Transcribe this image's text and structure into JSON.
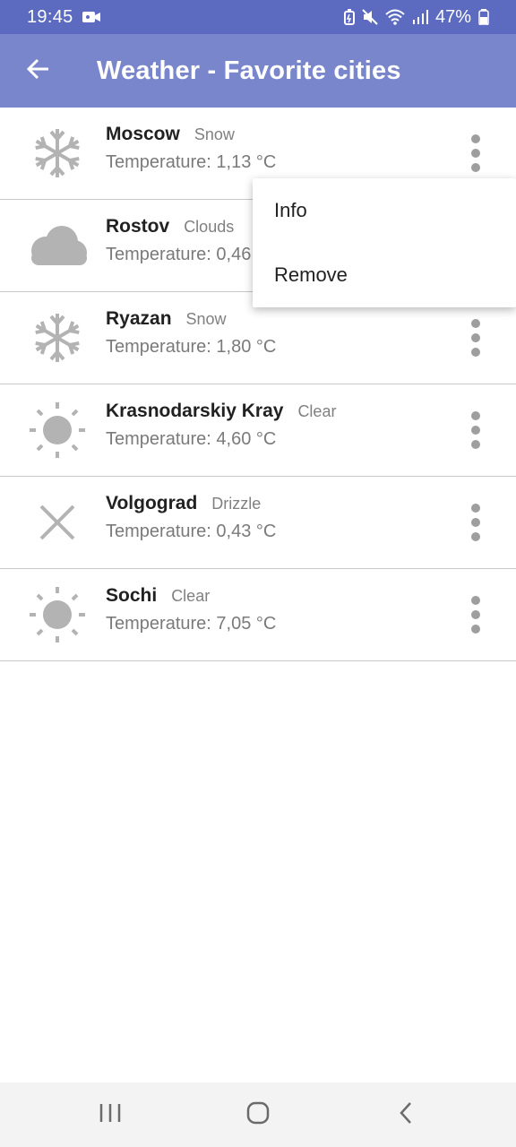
{
  "status_bar": {
    "time": "19:45",
    "battery": "47%",
    "icons": [
      "video-camera-icon",
      "battery-saver-icon",
      "mute-icon",
      "wifi-icon",
      "signal-icon",
      "battery-icon"
    ]
  },
  "app_bar": {
    "title": "Weather - Favorite cities",
    "back_icon": "arrow-left-icon"
  },
  "cities": [
    {
      "name": "Moscow",
      "condition": "Snow",
      "temperature": "Temperature: 1,13 °C",
      "icon": "snowflake-icon"
    },
    {
      "name": "Rostov",
      "condition": "Clouds",
      "temperature": "Temperature: 0,46",
      "icon": "cloud-icon"
    },
    {
      "name": "Ryazan",
      "condition": "Snow",
      "temperature": "Temperature: 1,80 °C",
      "icon": "snowflake-icon"
    },
    {
      "name": "Krasnodarskiy Kray",
      "condition": "Clear",
      "temperature": "Temperature: 4,60 °C",
      "icon": "sun-icon"
    },
    {
      "name": "Volgograd",
      "condition": "Drizzle",
      "temperature": "Temperature: 0,43 °C",
      "icon": "cross-icon"
    },
    {
      "name": "Sochi",
      "condition": "Clear",
      "temperature": "Temperature: 7,05 °C",
      "icon": "sun-icon"
    }
  ],
  "popup_menu": {
    "items": [
      "Info",
      "Remove"
    ]
  },
  "nav_bar": {
    "icons": [
      "recent-apps-icon",
      "home-icon",
      "back-icon"
    ]
  },
  "colors": {
    "status_bar": "#5c6bc0",
    "app_bar": "#7986cb",
    "icon_gray": "#b3b3b3"
  }
}
